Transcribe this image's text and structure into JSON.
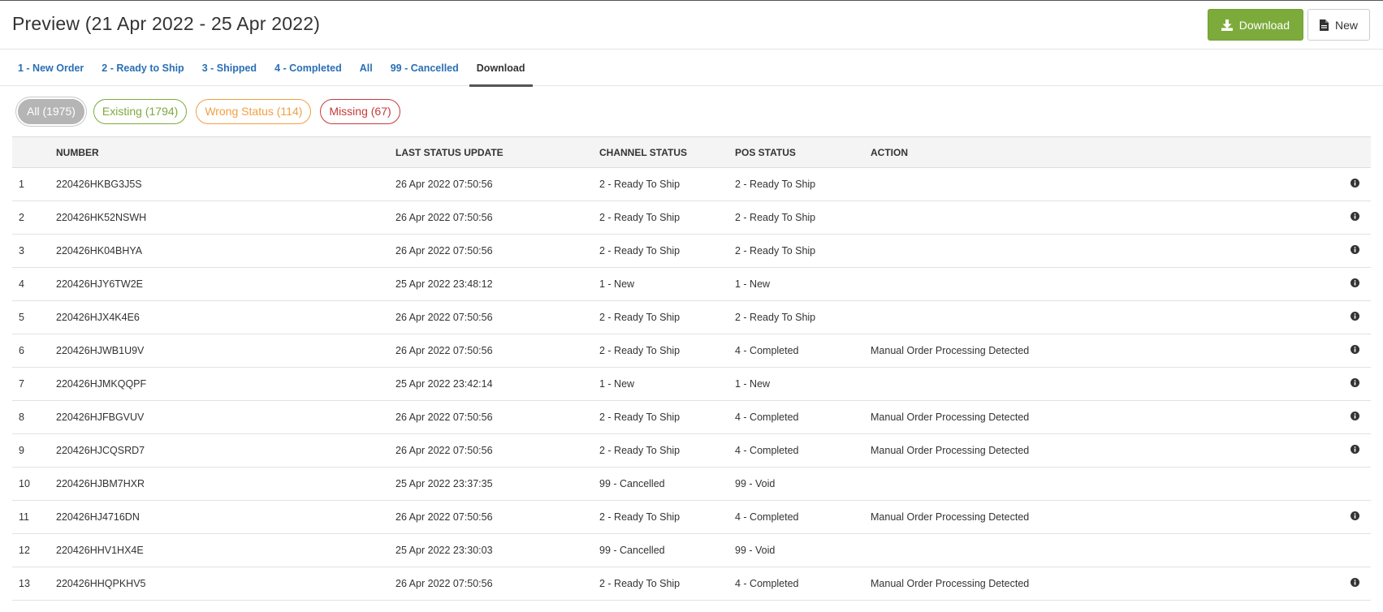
{
  "header": {
    "title": "Preview (21 Apr 2022 - 25 Apr 2022)",
    "download_label": "Download",
    "new_label": "New"
  },
  "tabs": [
    {
      "label": "1 - New Order",
      "active": false
    },
    {
      "label": "2 - Ready to Ship",
      "active": false
    },
    {
      "label": "3 - Shipped",
      "active": false
    },
    {
      "label": "4 - Completed",
      "active": false
    },
    {
      "label": "All",
      "active": false
    },
    {
      "label": "99 - Cancelled",
      "active": false
    },
    {
      "label": "Download",
      "active": true
    }
  ],
  "filters": {
    "all": "All (1975)",
    "existing": "Existing (1794)",
    "wrong_status": "Wrong Status (114)",
    "missing": "Missing (67)"
  },
  "table": {
    "columns": {
      "number": "NUMBER",
      "last_status_update": "LAST STATUS UPDATE",
      "channel_status": "CHANNEL STATUS",
      "pos_status": "POS STATUS",
      "action": "ACTION"
    },
    "rows": [
      {
        "idx": "1",
        "number": "220426HKBG3J5S",
        "date": "26 Apr 2022 07:50:56",
        "channel": "2 - Ready To Ship",
        "pos": "2 - Ready To Ship",
        "action": "",
        "info": true
      },
      {
        "idx": "2",
        "number": "220426HK52NSWH",
        "date": "26 Apr 2022 07:50:56",
        "channel": "2 - Ready To Ship",
        "pos": "2 - Ready To Ship",
        "action": "",
        "info": true
      },
      {
        "idx": "3",
        "number": "220426HK04BHYA",
        "date": "26 Apr 2022 07:50:56",
        "channel": "2 - Ready To Ship",
        "pos": "2 - Ready To Ship",
        "action": "",
        "info": true
      },
      {
        "idx": "4",
        "number": "220426HJY6TW2E",
        "date": "25 Apr 2022 23:48:12",
        "channel": "1 - New",
        "pos": "1 - New",
        "action": "",
        "info": true
      },
      {
        "idx": "5",
        "number": "220426HJX4K4E6",
        "date": "26 Apr 2022 07:50:56",
        "channel": "2 - Ready To Ship",
        "pos": "2 - Ready To Ship",
        "action": "",
        "info": true
      },
      {
        "idx": "6",
        "number": "220426HJWB1U9V",
        "date": "26 Apr 2022 07:50:56",
        "channel": "2 - Ready To Ship",
        "pos": "4 - Completed",
        "action": "Manual Order Processing Detected",
        "info": true
      },
      {
        "idx": "7",
        "number": "220426HJMKQQPF",
        "date": "25 Apr 2022 23:42:14",
        "channel": "1 - New",
        "pos": "1 - New",
        "action": "",
        "info": true
      },
      {
        "idx": "8",
        "number": "220426HJFBGVUV",
        "date": "26 Apr 2022 07:50:56",
        "channel": "2 - Ready To Ship",
        "pos": "4 - Completed",
        "action": "Manual Order Processing Detected",
        "info": true
      },
      {
        "idx": "9",
        "number": "220426HJCQSRD7",
        "date": "26 Apr 2022 07:50:56",
        "channel": "2 - Ready To Ship",
        "pos": "4 - Completed",
        "action": "Manual Order Processing Detected",
        "info": true
      },
      {
        "idx": "10",
        "number": "220426HJBM7HXR",
        "date": "25 Apr 2022 23:37:35",
        "channel": "99 - Cancelled",
        "pos": "99 - Void",
        "action": "",
        "info": false
      },
      {
        "idx": "11",
        "number": "220426HJ4716DN",
        "date": "26 Apr 2022 07:50:56",
        "channel": "2 - Ready To Ship",
        "pos": "4 - Completed",
        "action": "Manual Order Processing Detected",
        "info": true
      },
      {
        "idx": "12",
        "number": "220426HHV1HX4E",
        "date": "25 Apr 2022 23:30:03",
        "channel": "99 - Cancelled",
        "pos": "99 - Void",
        "action": "",
        "info": false
      },
      {
        "idx": "13",
        "number": "220426HHQPKHV5",
        "date": "26 Apr 2022 07:50:56",
        "channel": "2 - Ready To Ship",
        "pos": "4 - Completed",
        "action": "Manual Order Processing Detected",
        "info": true
      }
    ]
  },
  "colors": {
    "accent_green": "#7cab3c",
    "link_blue": "#2a6fb5",
    "warning_orange": "#f0a042",
    "danger_red": "#c63a3a"
  },
  "icons": {
    "download": "download-icon",
    "new": "file-icon",
    "info": "info-circle-icon"
  }
}
